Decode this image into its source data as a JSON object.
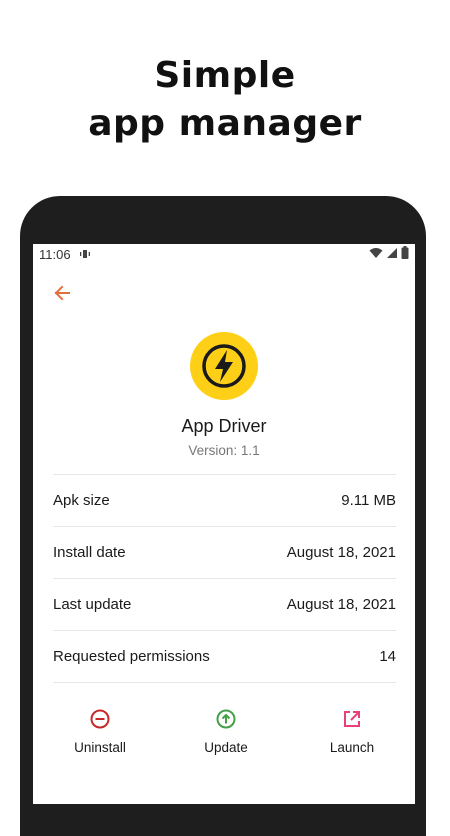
{
  "headline": {
    "line1": "Simple",
    "line2": "app manager"
  },
  "status_bar": {
    "time": "11:06",
    "icons": [
      "vibrate-icon",
      "wifi-icon",
      "signal-icon",
      "battery-icon"
    ]
  },
  "toolbar": {
    "back_icon": "arrow-left-icon"
  },
  "app": {
    "name": "App Driver",
    "version": "Version: 1.1",
    "icon": "lightning-bolt-icon"
  },
  "details": [
    {
      "label": "Apk size",
      "value": "9.11 MB"
    },
    {
      "label": "Install date",
      "value": "August 18, 2021"
    },
    {
      "label": "Last update",
      "value": "August 18, 2021"
    },
    {
      "label": "Requested permissions",
      "value": "14"
    }
  ],
  "actions": [
    {
      "label": "Uninstall",
      "icon": "minus-circle-icon",
      "color": "#c62828"
    },
    {
      "label": "Update",
      "icon": "arrow-up-circle-icon",
      "color": "#43a047"
    },
    {
      "label": "Launch",
      "icon": "open-external-icon",
      "color": "#e8407a"
    }
  ],
  "colors": {
    "accent": "#e0703c",
    "app_icon_bg": "#fdd017",
    "frame": "#1e1e1e"
  }
}
